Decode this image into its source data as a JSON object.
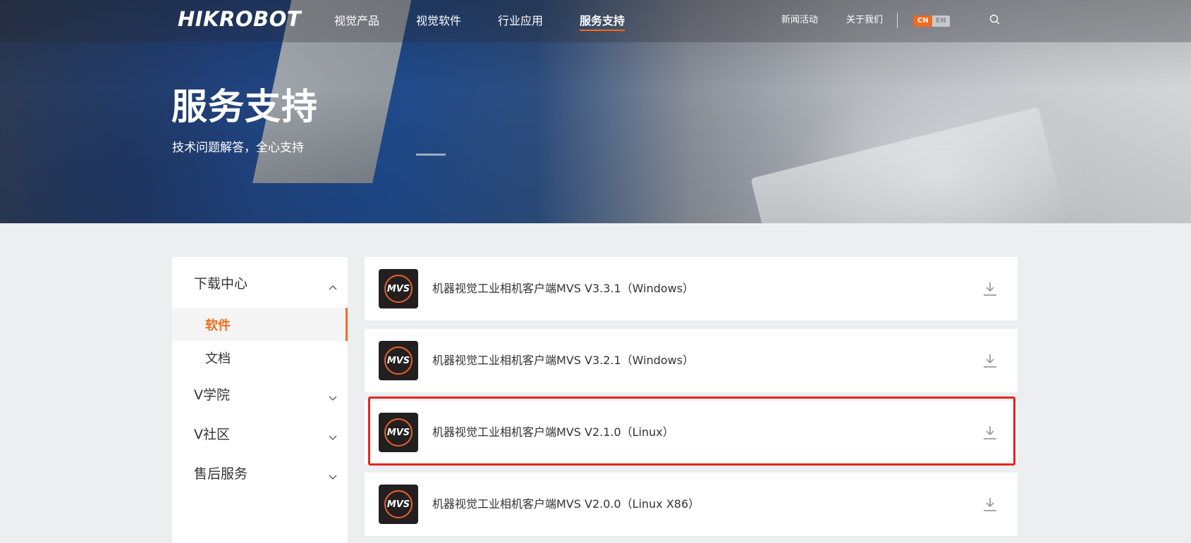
{
  "brand": {
    "logo_text": "HIKROBOT"
  },
  "nav": {
    "main": [
      "视觉产品",
      "视觉软件",
      "行业应用",
      "服务支持"
    ],
    "active_index": 3,
    "secondary": [
      "新闻活动",
      "关于我们"
    ],
    "lang": {
      "cn": "CN",
      "en": "EN",
      "active": "CN"
    },
    "search_icon": "search-icon"
  },
  "hero": {
    "title": "服务支持",
    "subtitle": "技术问题解答，全心支持"
  },
  "sidebar": {
    "downloads": {
      "label": "下载中心",
      "expanded": true,
      "items": [
        {
          "label": "软件",
          "active": true
        },
        {
          "label": "文档",
          "active": false
        }
      ]
    },
    "groups": [
      {
        "label": "V学院"
      },
      {
        "label": "V社区"
      },
      {
        "label": "售后服务"
      }
    ]
  },
  "downloads": [
    {
      "name": "机器视觉工业相机客户端MVS V3.3.1（Windows）",
      "icon_text": "MVS"
    },
    {
      "name": "机器视觉工业相机客户端MVS V3.2.1（Windows）",
      "icon_text": "MVS"
    },
    {
      "name": "机器视觉工业相机客户端MVS V2.1.0（Linux）",
      "icon_text": "MVS",
      "highlighted": true
    },
    {
      "name": "机器视觉工业相机客户端MVS V2.0.0（Linux X86）",
      "icon_text": "MVS"
    }
  ],
  "colors": {
    "accent": "#f06a1f",
    "highlight_border": "#e52420",
    "page_bg": "#edeef0"
  }
}
